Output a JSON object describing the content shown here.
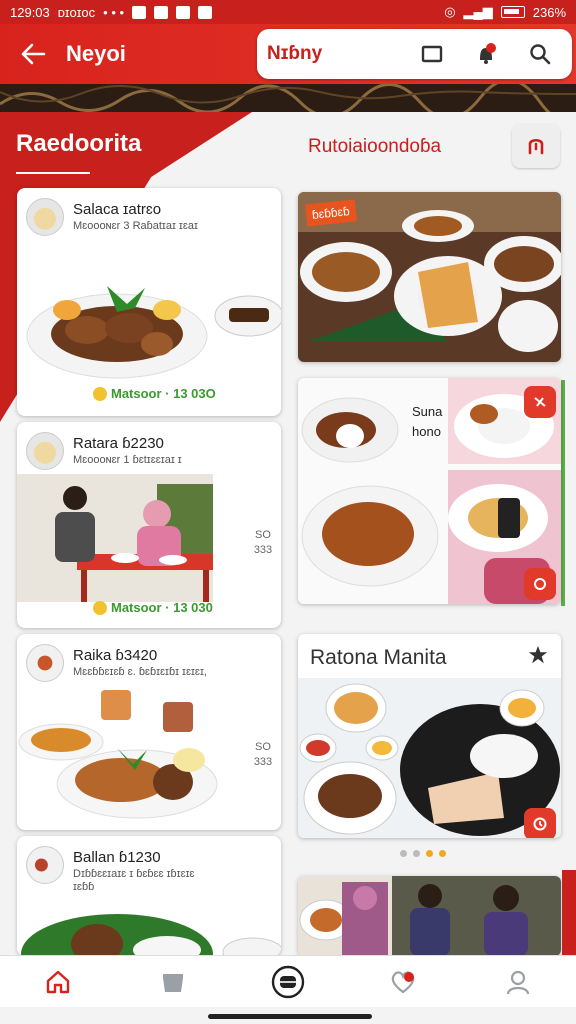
{
  "statusbar": {
    "time": "129:03",
    "carrier": "ᴅɪᴏɪᴏᴄ",
    "dots": "• • •",
    "battery": "236%"
  },
  "appbar": {
    "title": "Neyoi",
    "search_text": "Nɪɓny"
  },
  "section": {
    "left_title": "Raedoorita",
    "right_title": "Rutoiaioondoɓa"
  },
  "left_cards": [
    {
      "title": "Salaca ɪatrɛo",
      "subtitle": "Mɛoooɴɛr 3 Raɓatɪaɪ ɪɛaɪ",
      "meta": "Matsoor · 13 03O"
    },
    {
      "title": "Ratara ɓ2230",
      "subtitle": "Mɛoooɴɛr 1 ɓɛtɪɛɛɪaɪ ɪ",
      "meta": "Matsoor · 13 030",
      "side": [
        "SO",
        "333"
      ]
    },
    {
      "title": "Raika ɓ3420",
      "subtitle": "Mɛɛɓɓɛɪɛɓ ɛ. ɓɛɓɪɛɪɓɪ ɪɛɪɛɪ,",
      "side": [
        "SO",
        "333"
      ]
    },
    {
      "title": "Ballan ɓ1230",
      "subtitle": "Dɪɓɓɛɛɪaɪɛ ɪ ɓɛɓɛɛ ɪɓɪɛɪɛ",
      "subtitle2": "ɪɛɓɓ"
    }
  ],
  "right_cards": [
    {
      "badge": "ɓɛɓɓɛɓ"
    },
    {
      "label": [
        "Suna",
        "hono"
      ]
    },
    {
      "title": "Ratona Manita"
    }
  ],
  "icons": {
    "back": "back-arrow-icon",
    "menu": "tablet-icon",
    "bell": "notification-icon",
    "search": "search-icon",
    "filter": "filter-icon",
    "star": "star-icon",
    "home": "home-icon",
    "bowl": "bowl-icon",
    "center": "scan-icon",
    "heart": "heart-icon",
    "profile": "person-icon"
  },
  "colors": {
    "brand_red": "#d8231d",
    "accent_green": "#3a9a2f",
    "accent_orange": "#e8541d"
  }
}
